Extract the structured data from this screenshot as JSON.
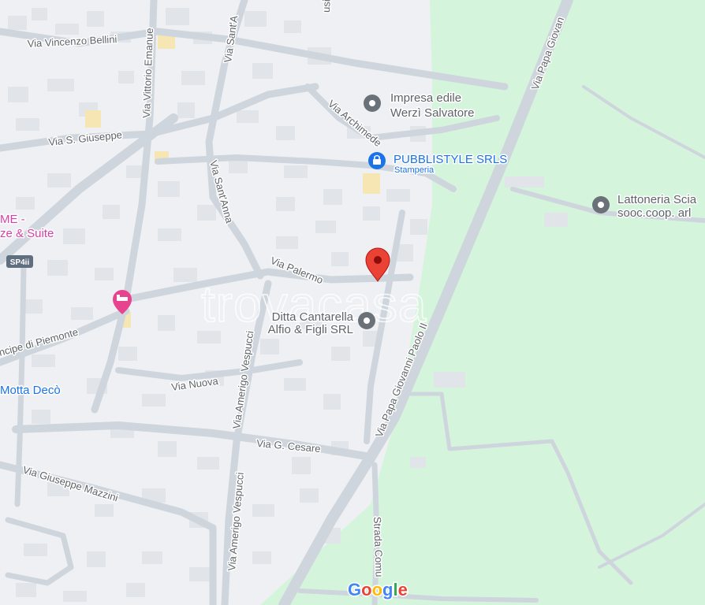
{
  "roads": {
    "via_vincenzo_bellini": "Via Vincenzo Bellini",
    "via_vittorio_emanuele": "Via Vittorio Emanue",
    "via_sant_a_top": "Via Sant'A",
    "via_s_giuseppe": "Via S. Giuseppe",
    "via_archimede": "Via Archimede",
    "via_sant_anna": "Via Sant'Anna",
    "via_palermo": "Via Palermo",
    "via_papa_giovanni_top": "Via Papa Giovan",
    "via_papa_giovanni_paolo": "Via Papa Giovanni Paolo II",
    "principe_piemonte": "ncipe di Piemonte",
    "via_nuova": "Via Nuova",
    "via_amerigo_vespucci": "Via Amerigo Vespucci",
    "via_amerigo_vespucci_2": "Via Amerigo Vespucci",
    "via_g_cesare": "Via G. Cesare",
    "via_giuseppe_mazzini": "Via Giuseppe Mazzini",
    "strada_comunale": "Strada Comu",
    "top_fragment": "usi",
    "sp_shield": "SP4ii"
  },
  "pois": {
    "impresa_line1": "Impresa edile",
    "impresa_line2": "Werzì Salvatore",
    "pubblistyle_name": "PUBBLISTYLE SRLS",
    "pubblistyle_sub": "Stamperia",
    "lattoneria_line1": "Lattoneria Scia",
    "lattoneria_line2": "sooc.coop. arl",
    "ditta_line1": "Ditta Cantarella",
    "ditta_line2": "Alfio & Figli SRL",
    "hotel_line1": "ME -",
    "hotel_line2": "ze & Suite",
    "motta_deco": "Motta Decò"
  },
  "watermark": "trovacasa",
  "google_logo": "Google",
  "colors": {
    "land": "#eef0f3",
    "park": "#d4f5dc",
    "road": "#cfd5dc",
    "pin": "#ea4335",
    "poi_gray": "#6b7178",
    "shop_blue": "#1a73e8",
    "hotel_pink": "#e8438f",
    "shield": "#5f6f80"
  },
  "icons": {
    "pin": "location-pin-icon",
    "poi": "place-marker-icon",
    "shop": "shopping-bag-icon",
    "hotel": "hotel-bed-icon"
  }
}
